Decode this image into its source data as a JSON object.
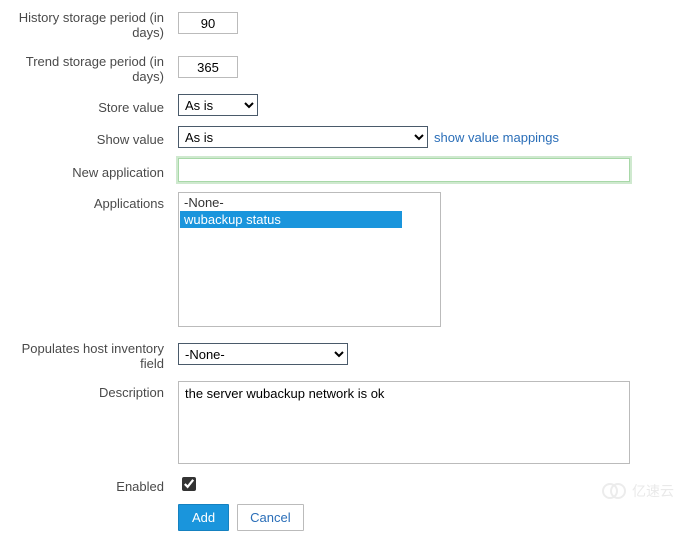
{
  "labels": {
    "history": "History storage period (in days)",
    "trend": "Trend storage period (in days)",
    "store_value": "Store value",
    "show_value": "Show value",
    "new_app": "New application",
    "applications": "Applications",
    "inventory": "Populates host inventory field",
    "description": "Description",
    "enabled": "Enabled"
  },
  "values": {
    "history": "90",
    "trend": "365",
    "store_value": "As is",
    "show_value": "As is",
    "new_app": "",
    "inventory": "-None-",
    "description": "the server wubackup network is ok",
    "enabled": true
  },
  "links": {
    "show_mappings": "show value mappings"
  },
  "applications": {
    "items": [
      {
        "label": "-None-",
        "selected": false
      },
      {
        "label": "wubackup status",
        "selected": true
      }
    ]
  },
  "buttons": {
    "add": "Add",
    "cancel": "Cancel"
  },
  "watermark": "亿速云"
}
